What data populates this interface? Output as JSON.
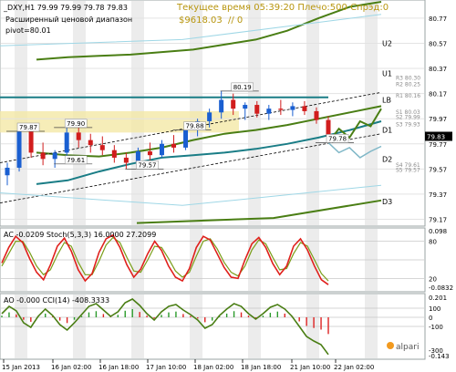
{
  "header": {
    "symbol_line": "_DXY,H1  79.99 79.99 79.78 79.83",
    "indicator_name": "Расширенный ценовой диапазон",
    "pivot_label": "pivot=80.01",
    "timer": "Текущее время 05:39:20 Плечо:500 Спрэд:0",
    "balance": "$9618.03",
    "balance_suffix": "// 0"
  },
  "chart_data": [
    {
      "type": "line",
      "title": "_DXY,H1",
      "x": [
        "15 Jan 2013",
        "16 Jan 02:00",
        "16 Jan 18:00",
        "17 Jan 10:00",
        "18 Jan 02:00",
        "18 Jan 18:00",
        "21 Jan 10:00",
        "22 Jan 02:00"
      ],
      "ylim": [
        79.13,
        80.9
      ],
      "yticks": [
        "80.77",
        "80.57",
        "80.37",
        "80.17",
        "79.97",
        "79.77",
        "79.57",
        "79.37",
        "79.17"
      ],
      "current_price": "79.83",
      "level_labels": [
        {
          "name": "U2",
          "value": 80.57
        },
        {
          "name": "U1",
          "value": 80.33
        },
        {
          "name": "R3",
          "value": 80.3
        },
        {
          "name": "R2",
          "value": 80.25
        },
        {
          "name": "R1",
          "value": 80.16
        },
        {
          "name": "LB",
          "value": 80.12
        },
        {
          "name": "S1",
          "value": 80.03
        },
        {
          "name": "S2",
          "value": 79.99
        },
        {
          "name": "D1",
          "value": 79.88
        },
        {
          "name": "S3",
          "value": 79.93
        },
        {
          "name": "D2",
          "value": 79.65
        },
        {
          "name": "S4",
          "value": 79.61
        },
        {
          "name": "S5",
          "value": 79.57
        },
        {
          "name": "D3",
          "value": 79.31
        }
      ],
      "price_annotations": [
        {
          "text": "79.87",
          "x_index": 1,
          "value": 79.87
        },
        {
          "text": "79.90",
          "x_index": 5,
          "value": 79.9
        },
        {
          "text": "79.61",
          "x_index": 5,
          "value": 79.61
        },
        {
          "text": "79.57",
          "x_index": 11,
          "value": 79.57
        },
        {
          "text": "79.88",
          "x_index": 15,
          "value": 79.88
        },
        {
          "text": "80.19",
          "x_index": 19,
          "value": 80.19
        },
        {
          "text": "79.78",
          "x_index": 27,
          "value": 79.78
        }
      ],
      "candles": [
        [
          79.52,
          79.62,
          79.44,
          79.58
        ],
        [
          79.58,
          79.9,
          79.55,
          79.87
        ],
        [
          79.87,
          79.88,
          79.66,
          79.7
        ],
        [
          79.7,
          79.78,
          79.6,
          79.65
        ],
        [
          79.65,
          79.72,
          79.58,
          79.7
        ],
        [
          79.7,
          79.92,
          79.61,
          79.86
        ],
        [
          79.86,
          79.9,
          79.74,
          79.8
        ],
        [
          79.8,
          79.85,
          79.7,
          79.76
        ],
        [
          79.76,
          79.83,
          79.68,
          79.72
        ],
        [
          79.72,
          79.76,
          79.62,
          79.66
        ],
        [
          79.66,
          79.7,
          79.57,
          79.62
        ],
        [
          79.62,
          79.74,
          79.57,
          79.71
        ],
        [
          79.71,
          79.78,
          79.64,
          79.68
        ],
        [
          79.68,
          79.8,
          79.66,
          79.77
        ],
        [
          79.77,
          79.84,
          79.7,
          79.74
        ],
        [
          79.74,
          79.9,
          79.72,
          79.88
        ],
        [
          79.88,
          79.97,
          79.83,
          79.95
        ],
        [
          79.95,
          80.05,
          79.9,
          80.02
        ],
        [
          80.02,
          80.19,
          79.97,
          80.12
        ],
        [
          80.12,
          80.17,
          80.0,
          80.05
        ],
        [
          80.05,
          80.1,
          79.96,
          80.08
        ],
        [
          80.08,
          80.11,
          79.98,
          80.01
        ],
        [
          80.01,
          80.08,
          79.96,
          80.05
        ],
        [
          80.05,
          80.12,
          80.0,
          80.04
        ],
        [
          80.04,
          80.1,
          79.99,
          80.07
        ],
        [
          80.07,
          80.11,
          80.0,
          80.03
        ],
        [
          80.03,
          80.06,
          79.93,
          79.96
        ],
        [
          79.96,
          79.99,
          79.78,
          79.83
        ]
      ],
      "ma": [
        {
          "name": "upper",
          "values": [
            80.44,
            80.46,
            80.47,
            80.48,
            80.5,
            80.52,
            80.56,
            80.6,
            80.67,
            80.77,
            80.86,
            80.9
          ]
        },
        {
          "name": "lower",
          "values": [
            79.45,
            79.48,
            79.55,
            79.61,
            79.66,
            79.68,
            79.7,
            79.73,
            79.77,
            79.82,
            79.88,
            79.95
          ]
        },
        {
          "name": "mid",
          "values": [
            79.7,
            79.68,
            79.67,
            79.7,
            79.74,
            79.8,
            79.85,
            79.88,
            79.92,
            79.97,
            80.02,
            80.07
          ]
        }
      ],
      "forecast": {
        "up": [
          79.78,
          79.89,
          79.82,
          79.95,
          79.91,
          80.05
        ],
        "down": [
          79.78,
          79.7,
          79.74,
          79.66,
          79.71,
          79.75
        ]
      },
      "colors": {
        "bull": "#1a5fd1",
        "bear": "#d11d1d",
        "bands": "#4a7e14",
        "mid": "#1a7d86",
        "zone": "#f4e9a6"
      }
    },
    {
      "type": "line",
      "title": "AC -0.0209  Stoch(5,3,3) 16.0000 27.2099",
      "ylim": [
        -0.0832,
        0.098
      ],
      "yticks": [
        "0.098",
        "80",
        "20",
        "-0.0832"
      ],
      "series": [
        {
          "name": "Stoch(5,3,3)",
          "values": [
            45,
            70,
            88,
            78,
            52,
            30,
            18,
            42,
            72,
            85,
            64,
            34,
            16,
            28,
            62,
            84,
            90,
            70,
            42,
            22,
            35,
            60,
            80,
            65,
            40,
            22,
            16,
            36,
            70,
            88,
            82,
            60,
            38,
            22,
            20,
            50,
            76,
            86,
            70,
            44,
            26,
            40,
            72,
            84,
            66,
            40,
            18,
            10
          ]
        },
        {
          "values": [
            40,
            60,
            80,
            80,
            62,
            40,
            26,
            34,
            58,
            78,
            72,
            46,
            26,
            26,
            48,
            74,
            86,
            78,
            54,
            32,
            30,
            50,
            72,
            70,
            52,
            32,
            22,
            30,
            56,
            80,
            84,
            68,
            46,
            30,
            24,
            40,
            66,
            82,
            76,
            54,
            34,
            36,
            60,
            78,
            72,
            50,
            28,
            16
          ]
        }
      ]
    },
    {
      "type": "line",
      "title": "AO -0.000  CCI(14) -408.3333",
      "ylim": [
        -0.143,
        0.201
      ],
      "yticks": [
        "0.201",
        "100",
        "0",
        "-100",
        "-300",
        "-0.143"
      ],
      "series": [
        {
          "name": "CCI(14)",
          "values": [
            40,
            120,
            70,
            -60,
            -110,
            10,
            90,
            20,
            -80,
            -140,
            -60,
            30,
            120,
            150,
            80,
            10,
            60,
            160,
            200,
            130,
            40,
            -30,
            60,
            120,
            140,
            80,
            30,
            -30,
            -120,
            -80,
            20,
            90,
            150,
            120,
            40,
            -20,
            40,
            110,
            140,
            90,
            10,
            -100,
            -210,
            -260,
            -300,
            -408
          ]
        }
      ]
    }
  ],
  "x_axis": {
    "labels": [
      "15 Jan 2013",
      "16 Jan 02:00",
      "16 Jan 18:00",
      "17 Jan 10:00",
      "18 Jan 02:00",
      "18 Jan 18:00",
      "21 Jan 10:00",
      "22 Jan 02:00"
    ]
  },
  "logo_text": "alpari"
}
